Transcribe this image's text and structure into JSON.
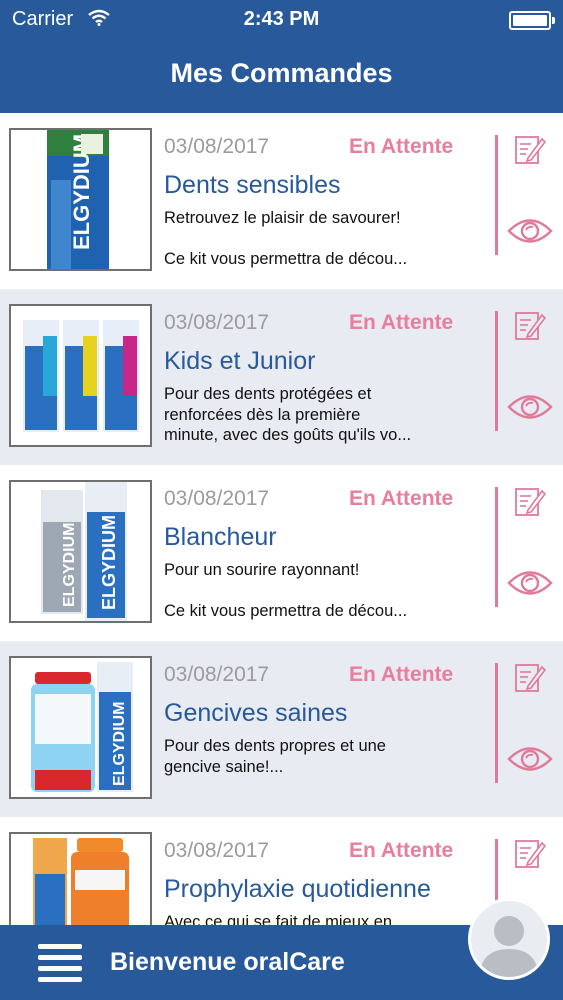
{
  "status_bar": {
    "carrier": "Carrier",
    "time": "2:43 PM"
  },
  "header": {
    "title": "Mes Commandes"
  },
  "orders": [
    {
      "date": "03/08/2017",
      "status": "En Attente",
      "title": "Dents sensibles",
      "lines": [
        "Retrouvez le plaisir de savourer!",
        "",
        "Ce kit vous permettra de décou..."
      ]
    },
    {
      "date": "03/08/2017",
      "status": "En Attente",
      "title": "Kids et Junior",
      "lines": [
        "Pour des dents protégées et",
        "renforcées dès la première",
        "minute, avec des goûts qu'ils vo..."
      ]
    },
    {
      "date": "03/08/2017",
      "status": "En Attente",
      "title": "Blancheur",
      "lines": [
        "Pour un sourire rayonnant!",
        "",
        "Ce kit vous permettra de décou..."
      ]
    },
    {
      "date": "03/08/2017",
      "status": "En Attente",
      "title": "Gencives saines",
      "lines": [
        "Pour des dents propres et une",
        "gencive saine!...",
        ""
      ]
    },
    {
      "date": "03/08/2017",
      "status": "En Attente",
      "title": "Prophylaxie quotidienne",
      "lines": [
        "Avec ce qui se fait de mieux en",
        "",
        ""
      ]
    }
  ],
  "footer": {
    "welcome": "Bienvenue oralCare"
  },
  "colors": {
    "brand_blue": "#27599b",
    "status_pink": "#ea7d9c",
    "row_alt": "#e8ebf2"
  },
  "icons": {
    "row_actions": [
      "edit-icon",
      "eye-icon"
    ],
    "footer": [
      "hamburger-menu-icon",
      "avatar-icon"
    ]
  }
}
